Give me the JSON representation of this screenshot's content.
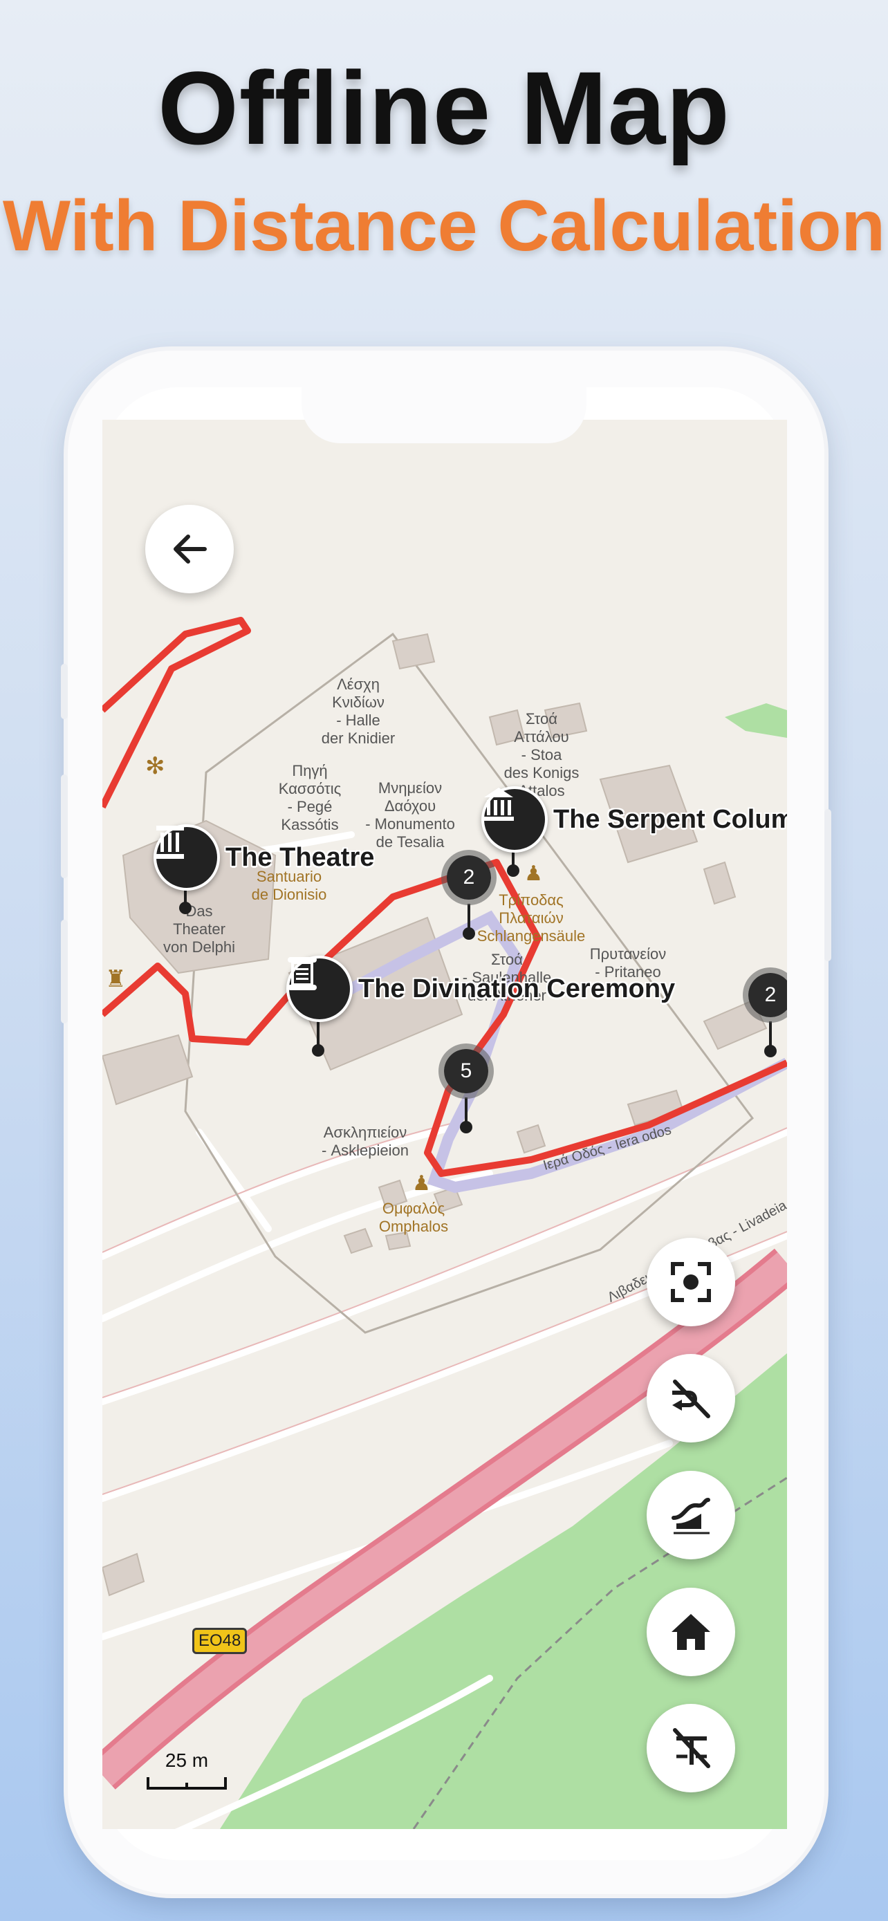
{
  "promo": {
    "title": "Offline Map",
    "subtitle": "With Distance Calculation"
  },
  "map": {
    "labels": [
      {
        "text": "Λέσχη\nΚνιδίων\n- Halle\nder Knidier",
        "brown": false
      },
      {
        "text": "Στοά\nΑττάλου\n- Stoa\ndes Konigs\nAttalos",
        "brown": false
      },
      {
        "text": "Πηγή\nΚασσότις\n- Pegé\nKassótis",
        "brown": false
      },
      {
        "text": "Μνημείον\nΔαόχου\n- Monumento\nde Tesalia",
        "brown": false
      },
      {
        "text": "Santuario\nde Dionisio",
        "brown": true
      },
      {
        "text": "Das\nTheater\nvon Delphi",
        "brown": false
      },
      {
        "text": "Στοά\n- Saulenhalle\nder Athener",
        "brown": false
      },
      {
        "text": "Τρίποδας\nΠλαταιών\nSchlangensäule",
        "brown": true
      },
      {
        "text": "Πρυτανείον\n- Pritaneo",
        "brown": false
      },
      {
        "text": "Ασκληπιείον\n- Asklepieion",
        "brown": false
      },
      {
        "text": "Ομφαλός\nOmphalos",
        "brown": true
      },
      {
        "text": "Ιερά Οδός - Iera odos",
        "brown": false
      },
      {
        "text": "Λιβαδειάς - Αράχωβας - Livadeia",
        "brown": false
      }
    ],
    "road_shield": "EO48",
    "scale_label": "25 m",
    "pois": [
      {
        "name": "The Theatre",
        "icon": "column-icon"
      },
      {
        "name": "The Serpent Column",
        "icon": "temple-icon"
      },
      {
        "name": "The Divination Ceremony",
        "icon": "scroll-icon"
      }
    ],
    "clusters": [
      "2",
      "5",
      "2"
    ],
    "route_color": "#e83b32",
    "accent_color": "#ef7d33"
  },
  "controls": {
    "back": "arrow-left-icon",
    "fabs": [
      "focus-target-icon",
      "path-off-icon",
      "elevation-profile-icon",
      "home-icon",
      "distance-off-icon"
    ]
  }
}
